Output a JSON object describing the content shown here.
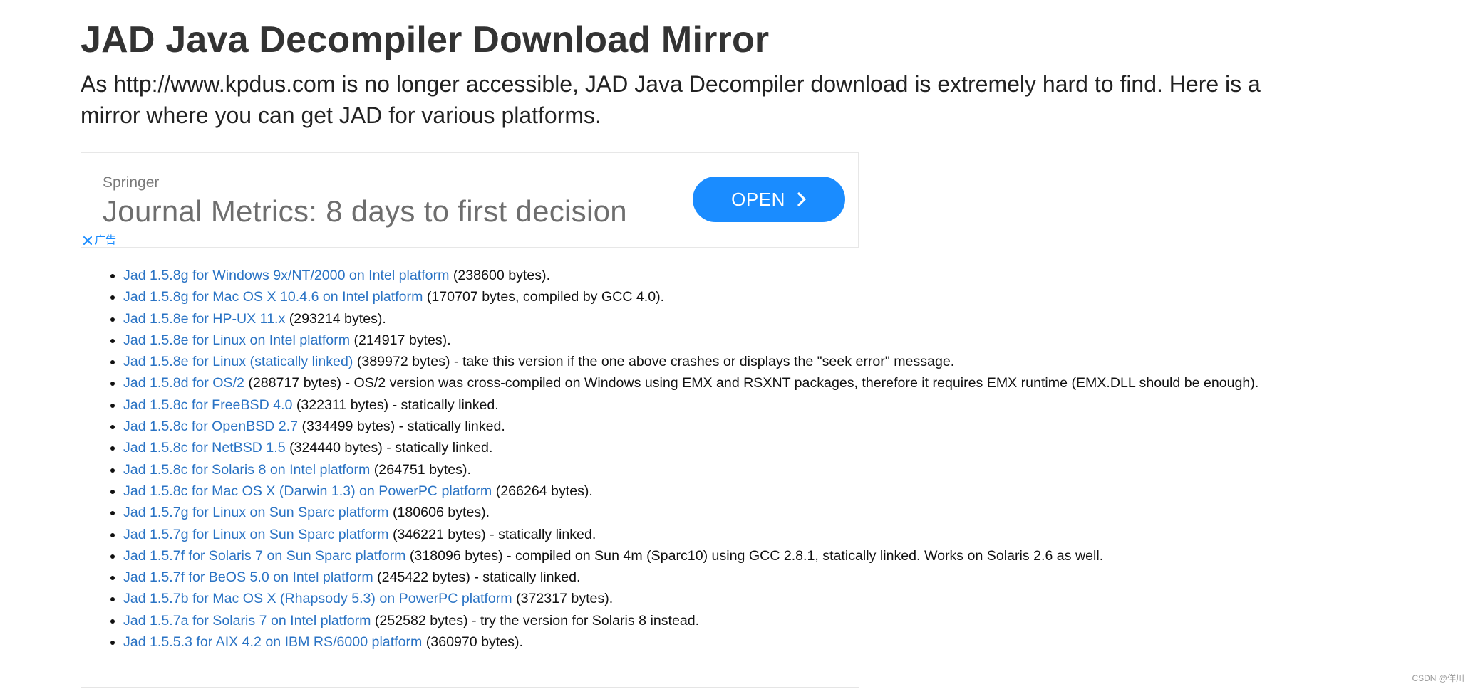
{
  "header": {
    "title": "JAD Java Decompiler Download Mirror",
    "intro": "As http://www.kpdus.com is no longer accessible, JAD Java Decompiler download is extremely hard to find. Here is a mirror where you can get JAD for various platforms."
  },
  "ad": {
    "brand": "Springer",
    "headline": "Journal Metrics: 8 days to first decision",
    "cta": "OPEN",
    "close_label": "广告",
    "accent_color": "#1a8cff"
  },
  "downloads": [
    {
      "link": "Jad 1.5.8g for Windows 9x/NT/2000 on Intel platform",
      "note": " (238600 bytes)."
    },
    {
      "link": "Jad 1.5.8g for Mac OS X 10.4.6 on Intel platform",
      "note": " (170707 bytes, compiled by GCC 4.0)."
    },
    {
      "link": "Jad 1.5.8e for HP-UX 11.x",
      "note": " (293214 bytes)."
    },
    {
      "link": "Jad 1.5.8e for Linux on Intel platform",
      "note": " (214917 bytes)."
    },
    {
      "link": "Jad 1.5.8e for Linux (statically linked)",
      "note": " (389972 bytes) - take this version if the one above crashes or displays the \"seek error\" message."
    },
    {
      "link": "Jad 1.5.8d for OS/2",
      "note": " (288717 bytes) - OS/2 version was cross-compiled on Windows using EMX and RSXNT packages, therefore it requires EMX runtime (EMX.DLL should be enough)."
    },
    {
      "link": "Jad 1.5.8c for FreeBSD 4.0",
      "note": " (322311 bytes) - statically linked."
    },
    {
      "link": "Jad 1.5.8c for OpenBSD 2.7",
      "note": " (334499 bytes) - statically linked."
    },
    {
      "link": "Jad 1.5.8c for NetBSD 1.5",
      "note": " (324440 bytes) - statically linked."
    },
    {
      "link": "Jad 1.5.8c for Solaris 8 on Intel platform",
      "note": " (264751 bytes)."
    },
    {
      "link": "Jad 1.5.8c for Mac OS X (Darwin 1.3) on PowerPC platform",
      "note": " (266264 bytes)."
    },
    {
      "link": "Jad 1.5.7g for Linux on Sun Sparc platform",
      "note": " (180606 bytes)."
    },
    {
      "link": "Jad 1.5.7g for Linux on Sun Sparc platform",
      "note": " (346221 bytes) - statically linked."
    },
    {
      "link": "Jad 1.5.7f for Solaris 7 on Sun Sparc platform",
      "note": " (318096 bytes) - compiled on Sun 4m (Sparc10) using GCC 2.8.1, statically linked. Works on Solaris 2.6 as well."
    },
    {
      "link": "Jad 1.5.7f for BeOS 5.0 on Intel platform",
      "note": " (245422 bytes) - statically linked."
    },
    {
      "link": "Jad 1.5.7b for Mac OS X (Rhapsody 5.3) on PowerPC platform",
      "note": " (372317 bytes)."
    },
    {
      "link": "Jad 1.5.7a for Solaris 7 on Intel platform",
      "note": " (252582 bytes) - try the version for Solaris 8 instead."
    },
    {
      "link": "Jad 1.5.5.3 for AIX 4.2 on IBM RS/6000 platform",
      "note": " (360970 bytes)."
    }
  ],
  "watermark": "CSDN @佯川",
  "colors": {
    "link": "#2a73c4",
    "title": "#333333"
  }
}
